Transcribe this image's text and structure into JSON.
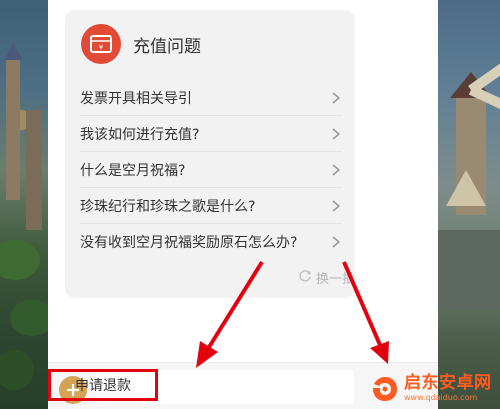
{
  "faq_card": {
    "title": "充值问题",
    "icon": "ticket-icon",
    "questions": [
      {
        "label": "发票开具相关导引"
      },
      {
        "label": "我该如何进行充值?"
      },
      {
        "label": "什么是空月祝福?"
      },
      {
        "label": "珍珠纪行和珍珠之歌是什么?"
      },
      {
        "label": "没有收到空月祝福奖励原石怎么办?"
      }
    ],
    "refresh_label": "换一批"
  },
  "input_bar": {
    "value": "申请退款",
    "plus_icon": "plus-icon"
  },
  "watermark": {
    "title": "启东安卓网",
    "subtitle": "www.qdaiduo.com"
  },
  "colors": {
    "icon_red": "#e34a36",
    "annotation_red": "#e3000f",
    "plus_gold": "#d5a356",
    "watermark_orange": "#ff5a1f"
  }
}
